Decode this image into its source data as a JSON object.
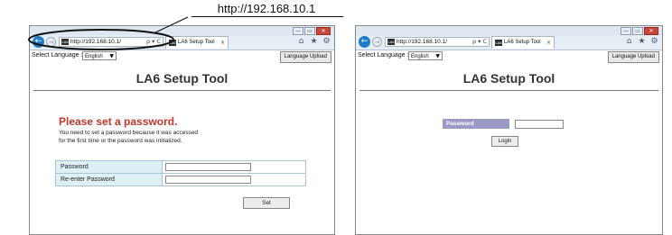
{
  "callout": {
    "url_label": "http://192.168.10.1"
  },
  "colors": {
    "accent_heading": "#c0392b",
    "form_label_bg": "#def0f6",
    "login_label_bg": "#9b9ac6",
    "back_button": "#1e7bc6"
  },
  "window_buttons": {
    "minimize": "—",
    "maximize": "▭",
    "close": "✕"
  },
  "windows": [
    {
      "url": "http://192.168.10.1/",
      "address_controls": "ρ ▾ C",
      "tab": {
        "title": "LA6 Setup Tool",
        "close": "×",
        "icon_text": "LA6"
      },
      "toolbar_icons": [
        "home-icon",
        "star-icon",
        "gear-icon"
      ],
      "language_label": "Select Language :",
      "language_value": "English",
      "upload_button": "Language Upload",
      "app_title": "LA6 Setup Tool",
      "heading": "Please set a password.",
      "description_line1": "You need to set a password because it was accessed",
      "description_line2": "for the first time or the password was initialized.",
      "fields": [
        {
          "label": "Password"
        },
        {
          "label": "Re-enter Password"
        }
      ],
      "set_button": "Set"
    },
    {
      "url": "http://192.168.10.1/",
      "address_controls": "ρ ▾ C",
      "tab": {
        "title": "LA6 Setup Tool",
        "close": "×",
        "icon_text": "LA6"
      },
      "toolbar_icons": [
        "home-icon",
        "star-icon",
        "gear-icon"
      ],
      "language_label": "Select Language :",
      "language_value": "English",
      "upload_button": "Language Upload",
      "app_title": "LA6 Setup Tool",
      "password_label": "Password",
      "login_button": "Login"
    }
  ]
}
